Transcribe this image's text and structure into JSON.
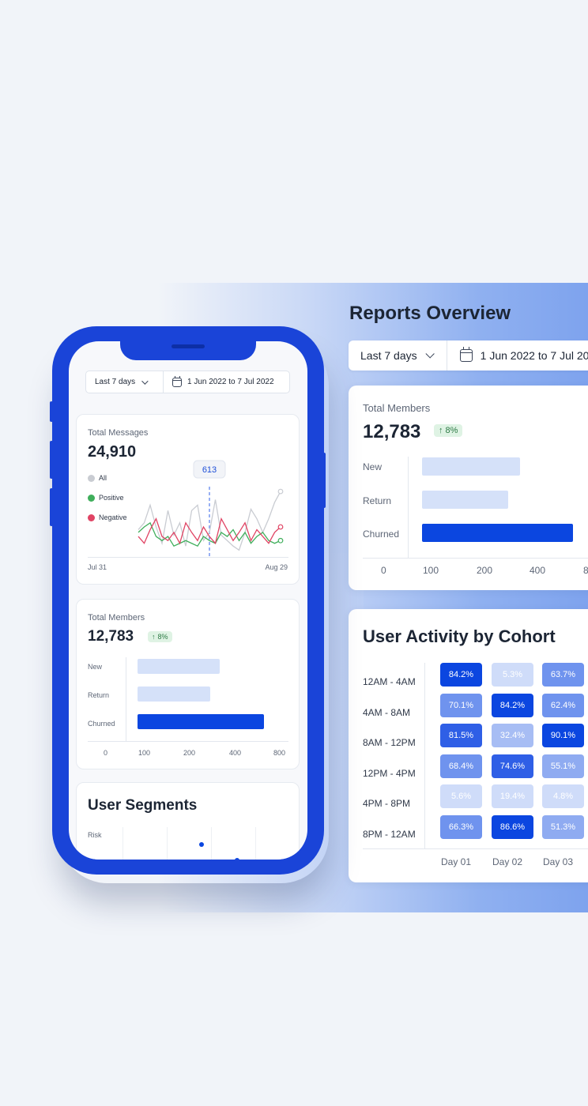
{
  "colors": {
    "brand_blue": "#0b46e0",
    "light_bar": "#d5e1f9",
    "positive": "#3fae5b",
    "negative": "#e04464",
    "all_series": "#c9ccd2",
    "badge_bg": "#dff3e4"
  },
  "icons": [
    "chevron-down-icon",
    "calendar-icon",
    "arrow-up-icon"
  ],
  "reports": {
    "title": "Reports Overview",
    "filter": {
      "range": "Last 7 days",
      "dates": "1 Jun 2022 to 7 Jul 2022"
    },
    "members": {
      "label": "Total Members",
      "value": "12,783",
      "change": "8%",
      "rows": [
        {
          "label": "New",
          "value": 500
        },
        {
          "label": "Return",
          "value": 440
        },
        {
          "label": "Churned",
          "value": 770
        }
      ],
      "ticks": [
        "0",
        "100",
        "200",
        "400",
        "800"
      ]
    },
    "cohort": {
      "title": "User Activity by Cohort",
      "rows": [
        "12AM - 4AM",
        "4AM - 8AM",
        "8AM - 12PM",
        "12PM - 4PM",
        "4PM - 8PM",
        "8PM - 12AM"
      ],
      "days": [
        "Day 01",
        "Day 02",
        "Day 03"
      ],
      "values": [
        [
          "84.2%",
          "5.3%",
          "63.7%"
        ],
        [
          "70.1%",
          "84.2%",
          "62.4%"
        ],
        [
          "81.5%",
          "32.4%",
          "90.1%"
        ],
        [
          "68.4%",
          "74.6%",
          "55.1%"
        ],
        [
          "5.6%",
          "19.4%",
          "4.8%"
        ],
        [
          "66.3%",
          "86.6%",
          "51.3%"
        ]
      ]
    }
  },
  "phone": {
    "filter": {
      "range": "Last 7 days",
      "dates": "1 Jun 2022 to 7 Jul 2022"
    },
    "messages": {
      "label": "Total Messages",
      "value": "24,910",
      "tooltip": "613",
      "legend": [
        "All",
        "Positive",
        "Negative"
      ],
      "x_start": "Jul 31",
      "x_end": "Aug 29"
    },
    "members": {
      "label": "Total Members",
      "value": "12,783",
      "change": "8%",
      "rows": [
        {
          "label": "New",
          "value": 500
        },
        {
          "label": "Return",
          "value": 440
        },
        {
          "label": "Churned",
          "value": 770
        }
      ],
      "ticks": [
        "0",
        "100",
        "200",
        "400",
        "800"
      ]
    },
    "segments": {
      "title": "User Segments",
      "row_label": "Risk"
    }
  },
  "chart_data": [
    {
      "type": "line",
      "title": "",
      "x_labels": [
        "Jul 31",
        "Aug 29"
      ],
      "series": [
        {
          "name": "All",
          "values": [
            50,
            55,
            68,
            52,
            40,
            64,
            46,
            55,
            38,
            64,
            68,
            42,
            48,
            72,
            46,
            42,
            38,
            35,
            48,
            65,
            58,
            48,
            58,
            70,
            78
          ]
        },
        {
          "name": "Positive",
          "values": [
            48,
            52,
            55,
            45,
            42,
            45,
            38,
            40,
            42,
            40,
            38,
            45,
            42,
            40,
            48,
            45,
            50,
            42,
            48,
            40,
            45,
            48,
            42,
            40,
            42
          ]
        },
        {
          "name": "Negative",
          "values": [
            45,
            40,
            50,
            58,
            45,
            42,
            48,
            40,
            55,
            48,
            42,
            52,
            45,
            40,
            58,
            50,
            42,
            48,
            55,
            42,
            50,
            45,
            40,
            48,
            52
          ]
        }
      ],
      "highlight": {
        "index": 12,
        "label": "613"
      }
    },
    {
      "type": "bar",
      "orientation": "horizontal",
      "title": "Total Members",
      "categories": [
        "New",
        "Return",
        "Churned"
      ],
      "values": [
        500,
        440,
        770
      ],
      "ticks": [
        "0",
        "100",
        "200",
        "400",
        "800"
      ]
    }
  ]
}
